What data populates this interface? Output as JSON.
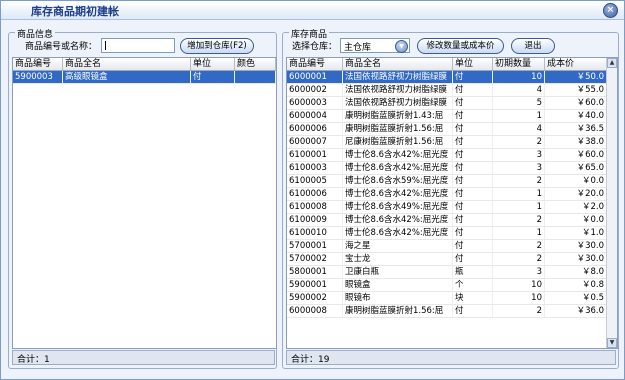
{
  "window": {
    "title": "库存商品期初建帐",
    "close_label": "×"
  },
  "left": {
    "group_title": "商品信息",
    "search_label": "商品编号或名称：",
    "search_value": "",
    "add_button": "增加到仓库(F2)",
    "columns": [
      "商品编号",
      "商品全名",
      "单位",
      "颜色"
    ],
    "rows": [
      {
        "code": "5900003",
        "name": "高级眼镜盒",
        "unit": "付",
        "color": ""
      }
    ],
    "footer": "合计：1"
  },
  "right": {
    "group_title": "库存商品",
    "warehouse_label": "选择仓库：",
    "warehouse_value": "主仓库",
    "modify_button": "修改数量或成本价",
    "exit_button": "退出",
    "columns": [
      "商品编号",
      "商品全名",
      "单位",
      "初期数量",
      "成本价"
    ],
    "rows": [
      {
        "code": "6000001",
        "name": "法国依视路舒视力树脂绿膜",
        "unit": "付",
        "qty": "10",
        "price": "￥50.0"
      },
      {
        "code": "6000002",
        "name": "法国依视路舒视力树脂绿膜",
        "unit": "付",
        "qty": "4",
        "price": "￥55.0"
      },
      {
        "code": "6000003",
        "name": "法国依视路舒视力树脂绿膜",
        "unit": "付",
        "qty": "5",
        "price": "￥60.0"
      },
      {
        "code": "6000004",
        "name": "康明树脂蓝膜折射1.43:屈",
        "unit": "付",
        "qty": "1",
        "price": "￥40.0"
      },
      {
        "code": "6000006",
        "name": "康明树脂蓝膜折射1.56:屈",
        "unit": "付",
        "qty": "4",
        "price": "￥36.5"
      },
      {
        "code": "6000007",
        "name": "尼康树脂蓝膜折射1.56:屈",
        "unit": "付",
        "qty": "2",
        "price": "￥38.0"
      },
      {
        "code": "6100001",
        "name": "博士伦8.6含水42%:屈光度",
        "unit": "付",
        "qty": "3",
        "price": "￥60.0"
      },
      {
        "code": "6100003",
        "name": "博士伦8.6含水42%:屈光度",
        "unit": "付",
        "qty": "3",
        "price": "￥65.0"
      },
      {
        "code": "6100005",
        "name": "博士伦8.6含水59%:屈光度",
        "unit": "付",
        "qty": "2",
        "price": "￥0.0"
      },
      {
        "code": "6100006",
        "name": "博士伦8.6含水42%:屈光度",
        "unit": "付",
        "qty": "1",
        "price": "￥20.0"
      },
      {
        "code": "6100008",
        "name": "博士伦8.6含水49%:屈光度",
        "unit": "付",
        "qty": "1",
        "price": "￥2.0"
      },
      {
        "code": "6100009",
        "name": "博士伦8.6含水42%:屈光度",
        "unit": "付",
        "qty": "2",
        "price": "￥0.0"
      },
      {
        "code": "6100010",
        "name": "博士伦8.6含水42%:屈光度",
        "unit": "付",
        "qty": "1",
        "price": "￥1.0"
      },
      {
        "code": "5700001",
        "name": "海之星",
        "unit": "付",
        "qty": "2",
        "price": "￥30.0"
      },
      {
        "code": "5700002",
        "name": "宝士龙",
        "unit": "付",
        "qty": "2",
        "price": "￥30.0"
      },
      {
        "code": "5800001",
        "name": "卫康白瓶",
        "unit": "瓶",
        "qty": "3",
        "price": "￥8.0"
      },
      {
        "code": "5900001",
        "name": "眼镜盒",
        "unit": "个",
        "qty": "10",
        "price": "￥0.8"
      },
      {
        "code": "5900002",
        "name": "眼镜布",
        "unit": "块",
        "qty": "10",
        "price": "￥0.5"
      },
      {
        "code": "6000008",
        "name": "康明树脂蓝膜折射1.56:屈",
        "unit": "付",
        "qty": "2",
        "price": "￥36.0"
      }
    ],
    "footer": "合计：19"
  },
  "colors": {
    "accent": "#3169c6",
    "title": "#1c3f8a",
    "border": "#9aaecb",
    "window_bg": "#eef3fb"
  },
  "icons": {
    "scroll_up": "triangle-up",
    "scroll_down": "triangle-down",
    "close": "close-icon",
    "dropdown": "chevron-down-icon"
  }
}
